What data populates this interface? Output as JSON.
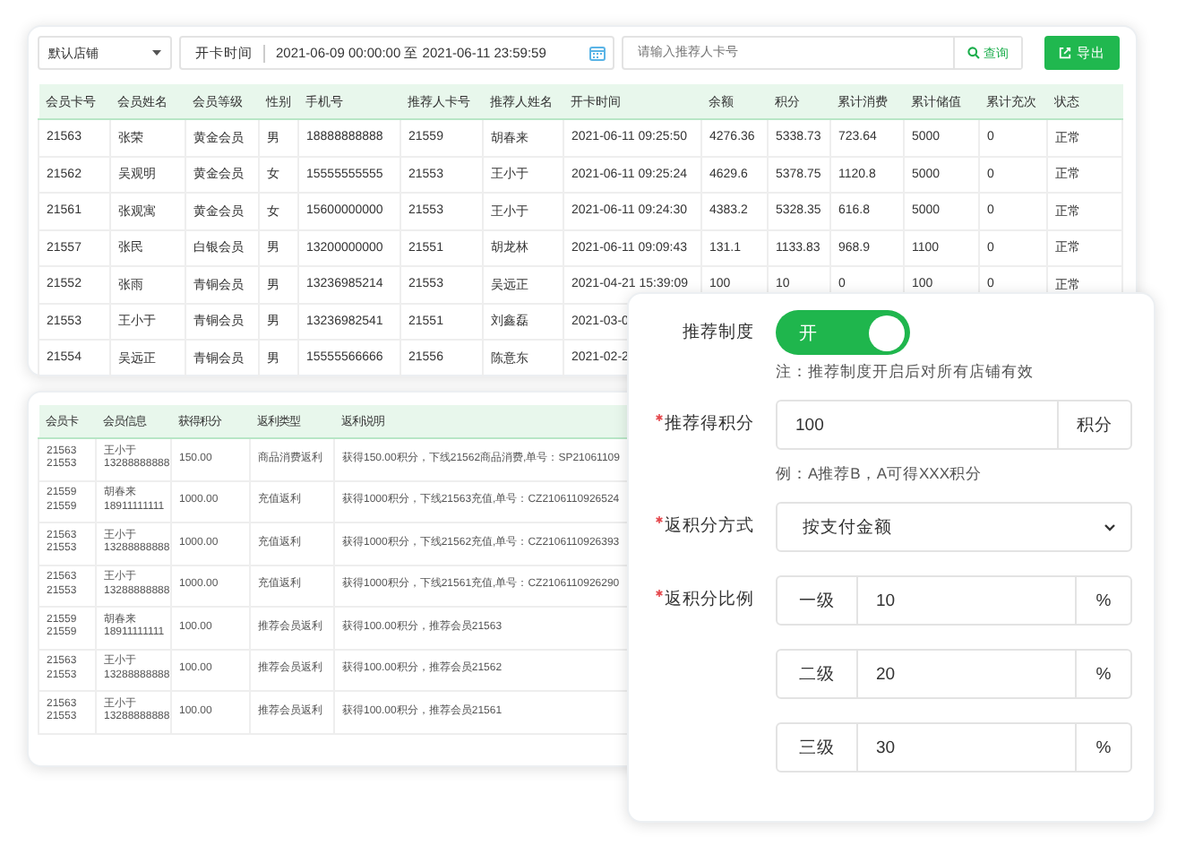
{
  "toolbar": {
    "store_select": "默认店铺",
    "date_label": "开卡时间",
    "date_range": "2021-06-09 00:00:00 至 2021-06-11 23:59:59",
    "search": {
      "placeholder": "请输入推荐人卡号"
    },
    "search_button": "查询",
    "export_button": "导出"
  },
  "members_table": {
    "columns": [
      "会员卡号",
      "会员姓名",
      "会员等级",
      "性别",
      "手机号",
      "推荐人卡号",
      "推荐人姓名",
      "开卡时间",
      "余额",
      "积分",
      "累计消费",
      "累计储值",
      "累计充次",
      "状态"
    ],
    "rows": [
      [
        "21563",
        "张荣",
        "黄金会员",
        "男",
        "18888888888",
        "21559",
        "胡春来",
        "2021-06-11 09:25:50",
        "4276.36",
        "5338.73",
        "723.64",
        "5000",
        "0",
        "正常"
      ],
      [
        "21562",
        "吴观明",
        "黄金会员",
        "女",
        "15555555555",
        "21553",
        "王小于",
        "2021-06-11 09:25:24",
        "4629.6",
        "5378.75",
        "1120.8",
        "5000",
        "0",
        "正常"
      ],
      [
        "21561",
        "张观寓",
        "黄金会员",
        "女",
        "15600000000",
        "21553",
        "王小于",
        "2021-06-11 09:24:30",
        "4383.2",
        "5328.35",
        "616.8",
        "5000",
        "0",
        "正常"
      ],
      [
        "21557",
        "张民",
        "白银会员",
        "男",
        "13200000000",
        "21551",
        "胡龙林",
        "2021-06-11 09:09:43",
        "131.1",
        "1133.83",
        "968.9",
        "1100",
        "0",
        "正常"
      ],
      [
        "21552",
        "张雨",
        "青铜会员",
        "男",
        "13236985214",
        "21553",
        "吴远正",
        "2021-04-21 15:39:09",
        "100",
        "10",
        "0",
        "100",
        "0",
        "正常"
      ],
      [
        "21553",
        "王小于",
        "青铜会员",
        "男",
        "13236982541",
        "21551",
        "刘鑫磊",
        "2021-03-0"
      ],
      [
        "21554",
        "吴远正",
        "青铜会员",
        "男",
        "15555566666",
        "21556",
        "陈意东",
        "2021-02-2"
      ]
    ]
  },
  "rebate_table": {
    "columns": [
      "会员卡",
      "会员信息",
      "获得积分",
      "返利类型",
      "返利说明"
    ],
    "rows": [
      {
        "cards": [
          "21563",
          "21553"
        ],
        "name": "王小于",
        "phone": "13288888888",
        "points": "150.00",
        "type": "商品消费返利",
        "note": "获得150.00积分，下线21562商品消费,单号：SP21061109"
      },
      {
        "cards": [
          "21559",
          "21559"
        ],
        "name": "胡春来",
        "phone": "18911111111",
        "points": "1000.00",
        "type": "充值返利",
        "note": "获得1000积分，下线21563充值,单号：CZ2106110926524"
      },
      {
        "cards": [
          "21563",
          "21553"
        ],
        "name": "王小于",
        "phone": "13288888888",
        "points": "1000.00",
        "type": "充值返利",
        "note": "获得1000积分，下线21562充值,单号：CZ2106110926393"
      },
      {
        "cards": [
          "21563",
          "21553"
        ],
        "name": "王小于",
        "phone": "13288888888",
        "points": "1000.00",
        "type": "充值返利",
        "note": "获得1000积分，下线21561充值,单号：CZ2106110926290"
      },
      {
        "cards": [
          "21559",
          "21559"
        ],
        "name": "胡春来",
        "phone": "18911111111",
        "points": "100.00",
        "type": "推荐会员返利",
        "note": "获得100.00积分，推荐会员21563"
      },
      {
        "cards": [
          "21563",
          "21553"
        ],
        "name": "王小于",
        "phone": "13288888888",
        "points": "100.00",
        "type": "推荐会员返利",
        "note": "获得100.00积分，推荐会员21562"
      },
      {
        "cards": [
          "21563",
          "21553"
        ],
        "name": "王小于",
        "phone": "13288888888",
        "points": "100.00",
        "type": "推荐会员返利",
        "note": "获得100.00积分，推荐会员21561"
      }
    ]
  },
  "referral_form": {
    "toggle": {
      "label": "推荐制度",
      "text": "开",
      "on": true
    },
    "toggle_note": "注：推荐制度开启后对所有店铺有效",
    "points": {
      "label": "推荐得积分",
      "required": true,
      "value": "100",
      "unit": "积分"
    },
    "points_hint": "例：A推荐B，A可得XXX积分",
    "method": {
      "label": "返积分方式",
      "required": true,
      "value": "按支付金额"
    },
    "ratio": {
      "label": "返积分比例",
      "required": true,
      "levels": [
        {
          "name": "一级",
          "value": "10",
          "unit": "%"
        },
        {
          "name": "二级",
          "value": "20",
          "unit": "%"
        },
        {
          "name": "三级",
          "value": "30",
          "unit": "%"
        }
      ]
    }
  }
}
